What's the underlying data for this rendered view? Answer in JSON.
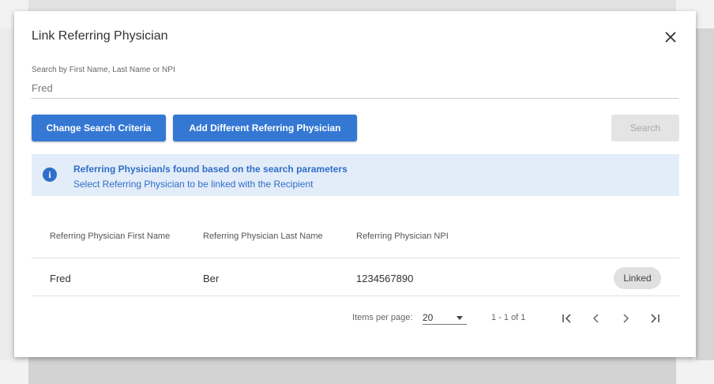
{
  "dialog": {
    "title": "Link Referring Physician"
  },
  "search": {
    "label": "Search by First Name, Last Name or NPI",
    "value": "Fred",
    "change_criteria_label": "Change Search Criteria",
    "add_different_label": "Add Different Referring Physician",
    "search_label": "Search"
  },
  "info": {
    "title": "Referring Physician/s found based on the search parameters",
    "subtitle": "Select Referring Physician to be linked with the Recipient"
  },
  "table": {
    "columns": [
      "Referring Physician First Name",
      "Referring Physician Last Name",
      "Referring Physician NPI"
    ],
    "rows": [
      {
        "first_name": "Fred",
        "last_name": "Ber",
        "npi": "1234567890",
        "status": "Linked"
      }
    ]
  },
  "pagination": {
    "items_per_page_label": "Items per page:",
    "items_per_page": "20",
    "range": "1 - 1 of 1"
  },
  "colors": {
    "primary": "#3478d4",
    "info_bg": "#e3ecf9",
    "info_text": "#2f6fc7",
    "disabled_bg": "#e4e4e4"
  },
  "icons": {
    "close": "close-icon",
    "info": "info-icon",
    "first_page": "first-page-icon",
    "prev_page": "chevron-left-icon",
    "next_page": "chevron-right-icon",
    "last_page": "last-page-icon",
    "dropdown": "caret-down-icon"
  }
}
